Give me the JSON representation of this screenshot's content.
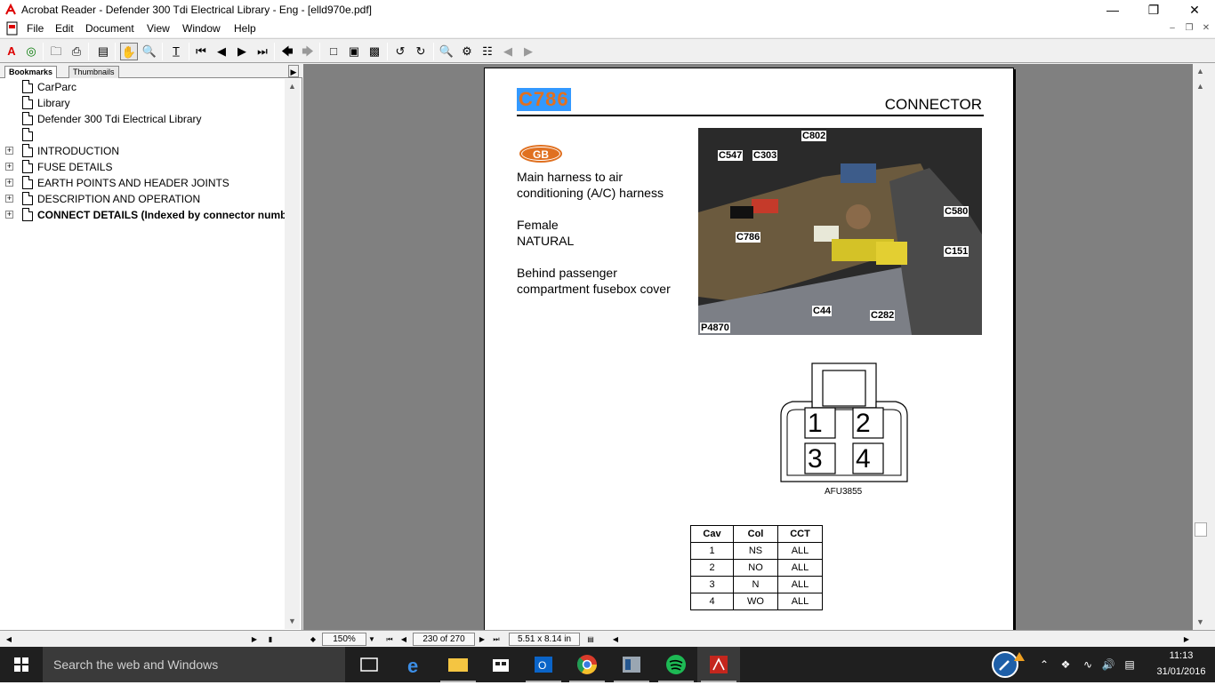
{
  "window": {
    "title": "Acrobat Reader - Defender 300 Tdi Electrical Library - Eng - [elld970e.pdf]",
    "minimize": "—",
    "restore": "❐",
    "close": "✕"
  },
  "menu": {
    "items": [
      "File",
      "Edit",
      "Document",
      "View",
      "Window",
      "Help"
    ]
  },
  "navpanel": {
    "tabs": [
      "Bookmarks",
      "Thumbnails"
    ],
    "bookmarks": [
      {
        "label": "CarParc",
        "expandable": false,
        "bold": false
      },
      {
        "label": "Library",
        "expandable": false,
        "bold": false
      },
      {
        "label": "Defender 300 Tdi Electrical Library",
        "expandable": false,
        "bold": false
      },
      {
        "label": "",
        "expandable": false,
        "bold": false
      },
      {
        "label": "INTRODUCTION",
        "expandable": true,
        "bold": false
      },
      {
        "label": "FUSE DETAILS",
        "expandable": true,
        "bold": false
      },
      {
        "label": "EARTH POINTS AND HEADER JOINTS",
        "expandable": true,
        "bold": false
      },
      {
        "label": "DESCRIPTION AND OPERATION",
        "expandable": true,
        "bold": false
      },
      {
        "label": "CONNECT DETAILS (Indexed by connector number)",
        "expandable": true,
        "bold": true
      }
    ]
  },
  "page": {
    "title": "C786",
    "heading": "CONNECTOR",
    "badge": "GB",
    "description_line1": "Main harness to air",
    "description_line2": "conditioning (A/C) harness",
    "gender": "Female",
    "color": "NATURAL",
    "location_line1": "Behind passenger",
    "location_line2": "compartment fusebox cover",
    "photo_id": "P4870",
    "photo_labels": [
      "C802",
      "C547",
      "C303",
      "C580",
      "C786",
      "C151",
      "C44",
      "C282"
    ],
    "diagram_id": "AFU3855",
    "pins": [
      "1",
      "2",
      "3",
      "4"
    ],
    "table": {
      "headers": [
        "Cav",
        "Col",
        "CCT"
      ],
      "rows": [
        [
          "1",
          "NS",
          "ALL"
        ],
        [
          "2",
          "NO",
          "ALL"
        ],
        [
          "3",
          "N",
          "ALL"
        ],
        [
          "4",
          "WO",
          "ALL"
        ]
      ]
    }
  },
  "status": {
    "zoom": "150%",
    "page": "230 of 270",
    "size": "5.51 x 8.14 in"
  },
  "taskbar": {
    "search_placeholder": "Search the web and Windows",
    "time": "11:13",
    "date": "31/01/2016"
  },
  "colors": {
    "accent_orange": "#e07020",
    "selection_blue": "#3399ff",
    "taskbar": "#1f1f1f",
    "doc_background": "#808080"
  }
}
